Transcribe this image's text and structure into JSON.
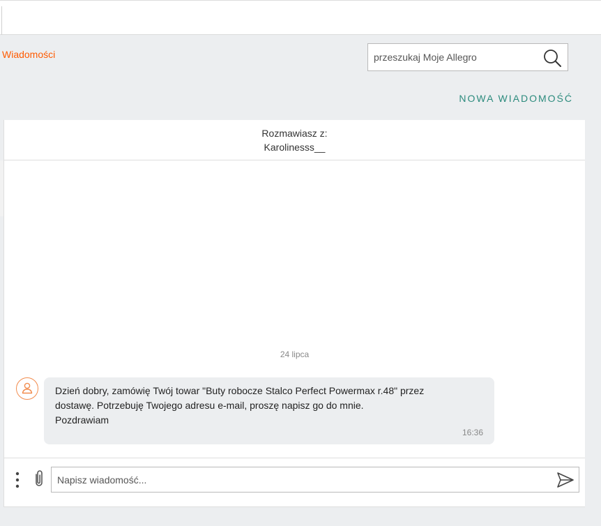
{
  "breadcrumb": {
    "label": "Wiadomości"
  },
  "search": {
    "placeholder": "przeszukaj Moje Allegro",
    "icon": "search-icon"
  },
  "actions": {
    "new_message": "NOWA WIADOMOŚĆ"
  },
  "conversation": {
    "with_label": "Rozmawiasz z:",
    "partner": "Karolinesss__"
  },
  "messages": {
    "date_separator": "24 lipca",
    "items": [
      {
        "lines": [
          "Dzień dobry, zamówię Twój towar \"Buty robocze Stalco Perfect Powermax r.48\" przez",
          "dostawę. Potrzebuję Twojego adresu e-mail, proszę napisz go do mnie.",
          "Pozdrawiam"
        ],
        "time": "16:36",
        "avatar_icon": "user-icon"
      }
    ]
  },
  "composer": {
    "placeholder": "Napisz wiadomość...",
    "more_icon": "more-vertical-icon",
    "attach_icon": "paperclip-icon",
    "send_icon": "send-icon"
  },
  "colors": {
    "accent": "#ff5a00",
    "teal": "#2c8b7d",
    "avatar_ring": "#f28c4e",
    "bubble_bg": "#eceef0",
    "page_bg": "#eceef0"
  }
}
